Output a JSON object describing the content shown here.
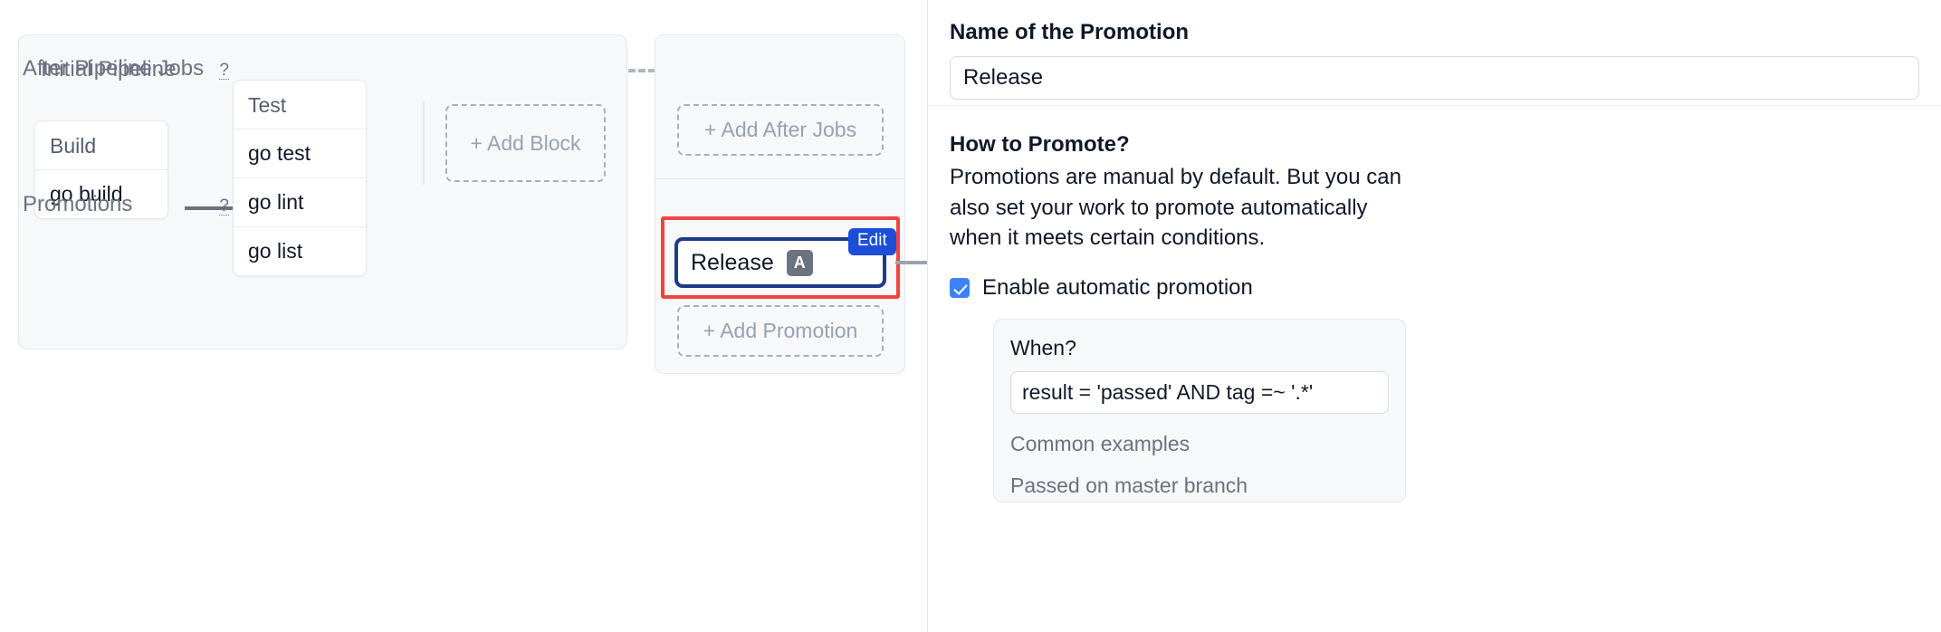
{
  "workflow": {
    "pipeline": {
      "title": "Initial Pipeline",
      "blocks": [
        {
          "name": "Build",
          "jobs": [
            "go build"
          ]
        },
        {
          "name": "Test",
          "jobs": [
            "go test",
            "go lint",
            "go list"
          ]
        }
      ],
      "add_block_label": "+ Add Block"
    },
    "after_pipeline_jobs": {
      "title": "After Pipeline Jobs",
      "help_glyph": "?",
      "add_label": "+ Add After Jobs"
    },
    "promotions": {
      "title": "Promotions",
      "help_glyph": "?",
      "add_label": "+ Add Promotion",
      "selected": {
        "label": "Release",
        "auto_chip": "A",
        "edit_badge": "Edit"
      }
    }
  },
  "panel": {
    "name_section": {
      "label": "Name of the Promotion",
      "value": "Release",
      "placeholder": "Name of the Promotion"
    },
    "how_section": {
      "title": "How to Promote?",
      "description": "Promotions are manual by default. But you can also set your work to promote automatically when it meets certain conditions.",
      "checkbox_label": "Enable automatic promotion",
      "checkbox_checked": true,
      "when": {
        "label": "When?",
        "value": "result = 'passed' AND tag =~ '.*'",
        "placeholder": "result = 'passed'",
        "examples_title": "Common examples",
        "examples": [
          "Passed on master branch"
        ]
      }
    }
  },
  "colors": {
    "highlight_red": "#ef4444",
    "selected_navy": "#1e3a8a",
    "edit_blue": "#1d4ed8",
    "checkbox_blue": "#3b82f6",
    "chip_gray": "#6b7280"
  }
}
